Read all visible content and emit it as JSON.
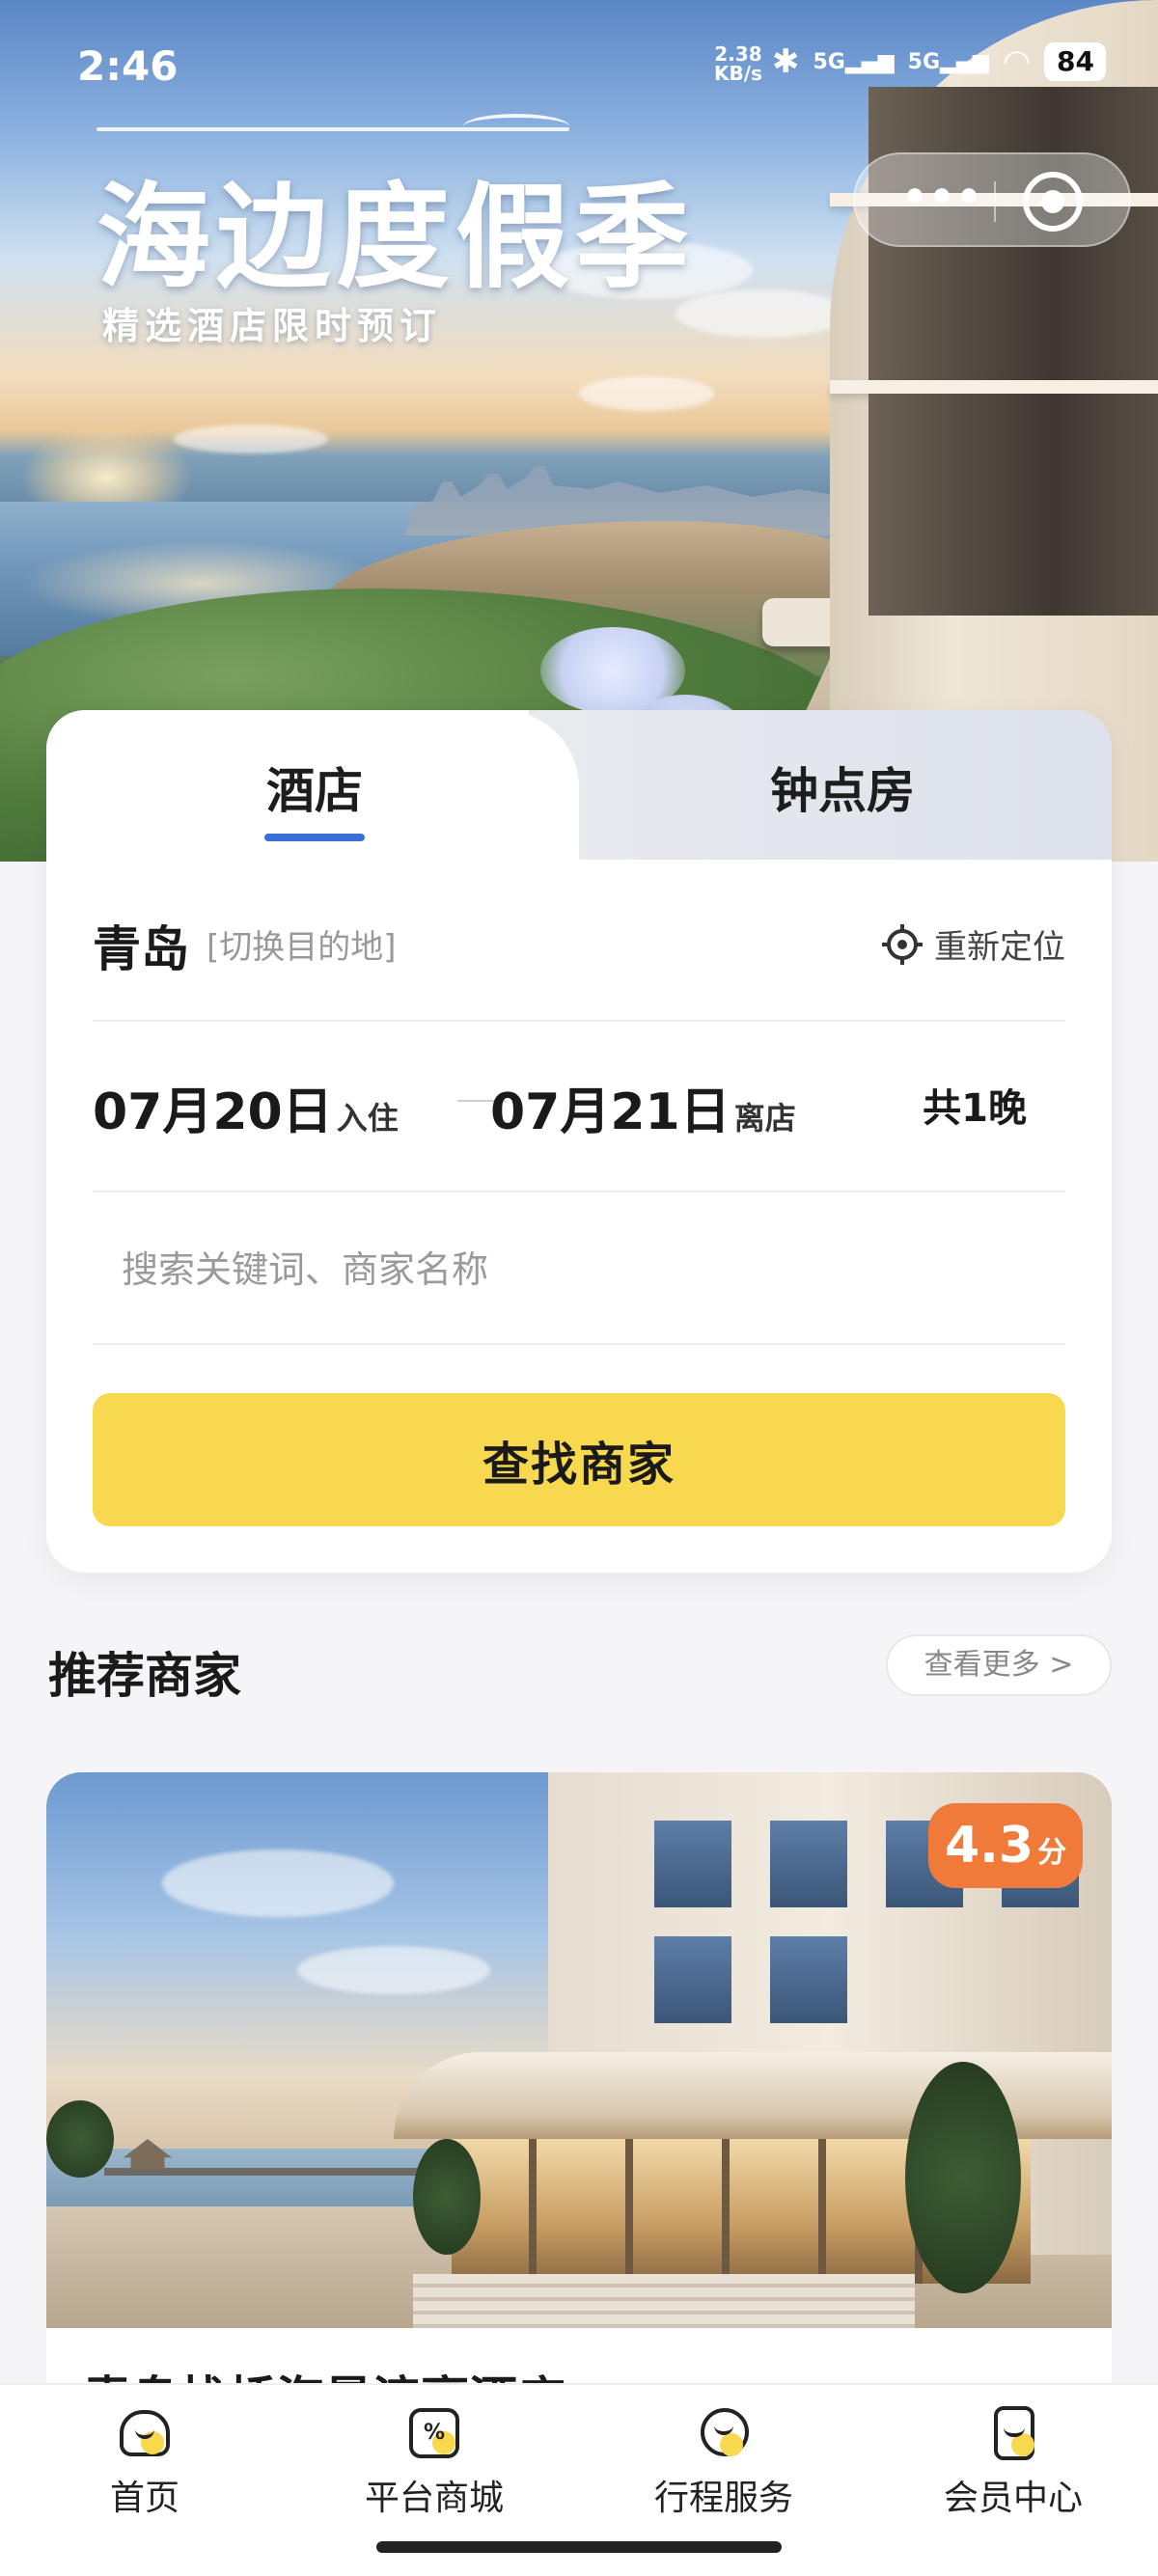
{
  "status_bar": {
    "time": "2:46",
    "net_speed": "2.38",
    "net_unit": "KB/s",
    "signal_1": "5G",
    "signal_2": "5G",
    "battery": "84"
  },
  "hero": {
    "title": "海边度假季",
    "subtitle": "精选酒店限时预订"
  },
  "capsule": {
    "more_label": "•••"
  },
  "booking": {
    "tabs": [
      {
        "label": "酒店",
        "active": true
      },
      {
        "label": "钟点房",
        "active": false
      }
    ],
    "city": "青岛",
    "switch_label": "[切换目的地]",
    "relocate_label": "重新定位",
    "checkin_date": "07月20日",
    "checkin_tag": "入住",
    "checkout_date": "07月21日",
    "checkout_tag": "离店",
    "nights": "共1晚",
    "search_placeholder": "搜索关键词、商家名称",
    "search_value": "",
    "search_button": "查找商家"
  },
  "recommend": {
    "title": "推荐商家",
    "more_label": "查看更多 >",
    "hotel": {
      "name": "青岛栈桥海景滨豪酒店",
      "score": "4.3",
      "score_unit": "分"
    }
  },
  "tabbar": {
    "items": [
      {
        "label": "首页",
        "icon": "home-icon"
      },
      {
        "label": "平台商城",
        "icon": "mall-icon"
      },
      {
        "label": "行程服务",
        "icon": "trip-icon"
      },
      {
        "label": "会员中心",
        "icon": "member-icon"
      }
    ]
  },
  "colors": {
    "accent_yellow": "#f8d84e",
    "tab_underline": "#3b6fd6",
    "score_orange": "#f07a3a"
  }
}
